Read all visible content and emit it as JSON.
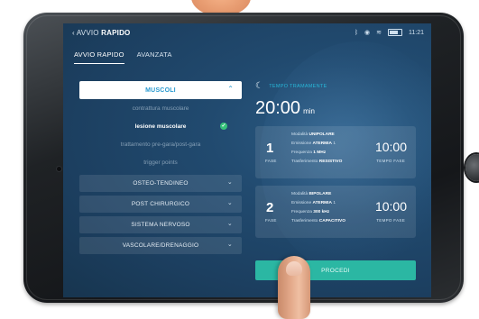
{
  "statusbar": {
    "back_prefix": "AVVIO",
    "back_bold": "RAPIDO",
    "icons": [
      "bluetooth-icon",
      "record-icon",
      "wifi-icon",
      "battery-icon"
    ],
    "time": "11:21"
  },
  "tabs": [
    {
      "label": "AVVIO RAPIDO",
      "active": true
    },
    {
      "label": "AVANZATA",
      "active": false
    }
  ],
  "left": {
    "dropdown": {
      "label": "MUSCOLI",
      "expanded": true
    },
    "sub_items": [
      {
        "label": "contrattura muscolare",
        "selected": false
      },
      {
        "label": "lesione muscolare",
        "selected": true
      },
      {
        "label": "trattamento pre-gara/post-gara",
        "selected": false
      },
      {
        "label": "trigger points",
        "selected": false
      }
    ],
    "categories": [
      {
        "label": "OSTEO-TENDINEO"
      },
      {
        "label": "POST CHIRURGICO"
      },
      {
        "label": "SISTEMA NERVOSO"
      },
      {
        "label": "VASCOLARE/DRENAGGIO"
      }
    ]
  },
  "right": {
    "total_label": "TEMPO TRAMAMENTE",
    "total_time": "20:00",
    "total_unit": "min",
    "phases": [
      {
        "number": "1",
        "number_label": "FASE",
        "mode_prefix": "Modalità",
        "mode": "UNIPOLARE",
        "emission_prefix": "Emissione",
        "emission": "ATERMIA",
        "emission_level": "1",
        "freq_prefix": "Frequenza",
        "freq": "1 MHz",
        "transfer_prefix": "Trasferimento",
        "transfer": "RESISTIVO",
        "time": "10:00",
        "time_label": "TEMPO FASE"
      },
      {
        "number": "2",
        "number_label": "FASE",
        "mode_prefix": "Modalità",
        "mode": "BIPOLARE",
        "emission_prefix": "Emissione",
        "emission": "ATERMIA",
        "emission_level": "1",
        "freq_prefix": "Frequenza",
        "freq": "300 kHz",
        "transfer_prefix": "Trasferimento",
        "transfer": "CAPACITIVO",
        "time": "10:00",
        "time_label": "TEMPO FASE"
      }
    ],
    "proceed_label": "PROCEDI"
  },
  "colors": {
    "accent": "#2a9ad0",
    "proceed": "#2bb7a3",
    "check": "#36c27a",
    "screen_bg": "#1c3f60"
  }
}
